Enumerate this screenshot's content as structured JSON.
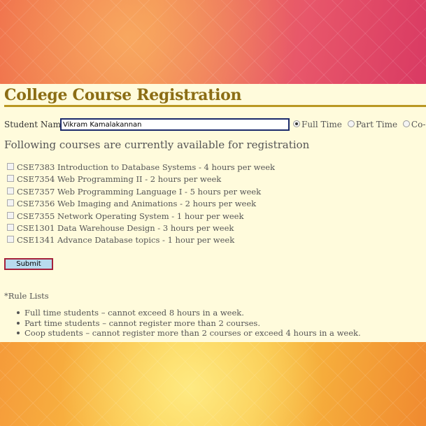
{
  "header": {
    "title": "College Course Registration"
  },
  "student": {
    "label": "Student Name:",
    "name_value": "Vikram Kamalakannan",
    "status_options": [
      {
        "label": "Full Time",
        "selected": true
      },
      {
        "label": "Part Time",
        "selected": false
      },
      {
        "label": "Co-op",
        "selected": false
      }
    ]
  },
  "courses": {
    "intro": "Following courses are currently available for registration",
    "items": [
      {
        "label": "CSE7383 Introduction to Database Systems - 4 hours per week",
        "checked": false
      },
      {
        "label": "CSE7354 Web Programming II - 2 hours per week",
        "checked": false
      },
      {
        "label": "CSE7357 Web Programming Language I - 5 hours per week",
        "checked": false
      },
      {
        "label": "CSE7356 Web Imaging and Animations - 2 hours per week",
        "checked": false
      },
      {
        "label": "CSE7355 Network Operating System - 1 hour per week",
        "checked": false
      },
      {
        "label": "CSE1301 Data Warehouse Design - 3 hours per week",
        "checked": false
      },
      {
        "label": "CSE1341 Advance Database topics - 1 hour per week",
        "checked": false
      }
    ]
  },
  "form": {
    "submit_label": "Submit"
  },
  "rules": {
    "heading": "*Rule Lists",
    "items": [
      "Full time students – cannot exceed 8 hours in a week.",
      "Part time students – cannot register more than 2 courses.",
      "Coop students – cannot register more than 2 courses or exceed 4 hours in a week."
    ]
  },
  "colors": {
    "title": "#8b6d14",
    "rule_line": "#b99722",
    "page_background": "#fffbdc",
    "submit_border": "#a5213b",
    "submit_fill": "#b8dbee"
  }
}
